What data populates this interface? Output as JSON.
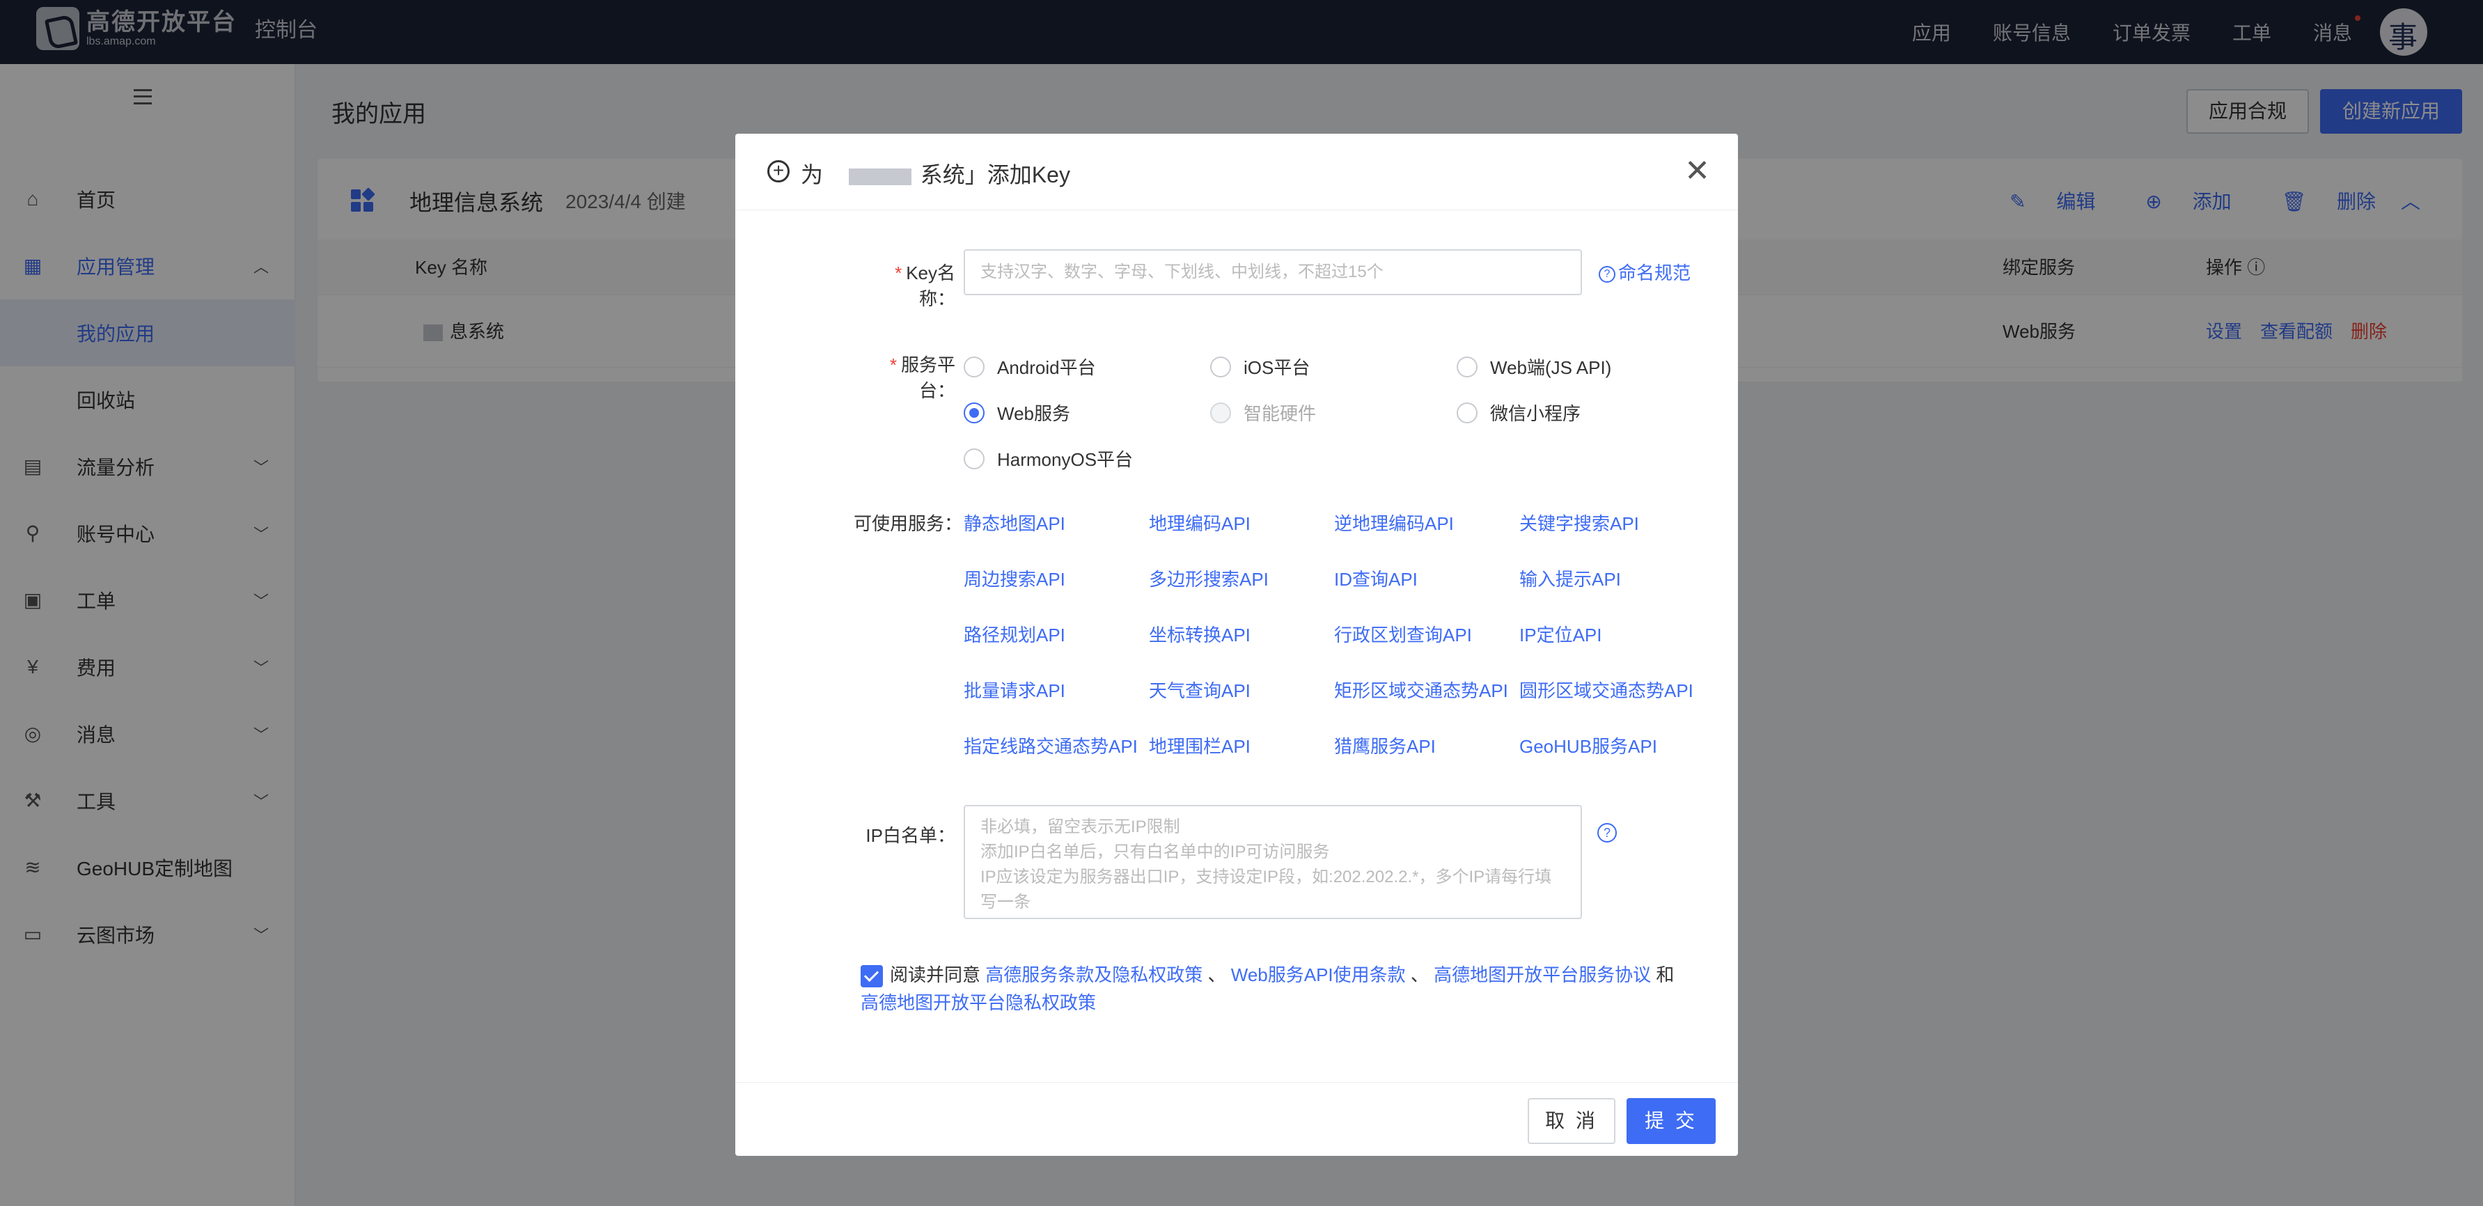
{
  "topbar": {
    "logo_name": "高德开放平台",
    "logo_domain": "lbs.amap.com",
    "console": "控制台",
    "nav": [
      "应用",
      "账号信息",
      "订单发票",
      "工单",
      "消息"
    ]
  },
  "sidebar": {
    "items": [
      {
        "label": "首页",
        "icon": "home-icon"
      },
      {
        "label": "应用管理",
        "icon": "grid-icon"
      },
      {
        "label": "我的应用"
      },
      {
        "label": "回收站"
      },
      {
        "label": "流量分析",
        "icon": "chart-icon"
      },
      {
        "label": "账号中心",
        "icon": "user-icon"
      },
      {
        "label": "工单",
        "icon": "ticket-icon"
      },
      {
        "label": "费用",
        "icon": "billing-icon"
      },
      {
        "label": "消息",
        "icon": "message-icon"
      },
      {
        "label": "工具",
        "icon": "wrench-icon"
      },
      {
        "label": "GeoHUB定制地图",
        "icon": "layers-icon"
      },
      {
        "label": "云图市场",
        "icon": "store-icon"
      }
    ]
  },
  "main": {
    "page_title": "我的应用",
    "compliance_button": "应用合规",
    "create_button": "创建新应用",
    "card": {
      "title": "地理信息系统",
      "date": "2023/4/4 创建",
      "actions": [
        "编辑",
        "添加",
        "删除"
      ],
      "columns": [
        "Key 名称",
        "绑定服务",
        "操作"
      ],
      "row": {
        "name": "息系统",
        "service": "Web服务",
        "ops": [
          "设置",
          "查看配额",
          "删除"
        ]
      }
    }
  },
  "modal": {
    "title_prefix": "为",
    "title_suffix": "系统」添加Key",
    "key_label": "Key名称：",
    "key_placeholder": "支持汉字、数字、字母、下划线、中划线，不超过15个",
    "naming_rule": "命名规范",
    "platform_label": "服务平台：",
    "platforms": [
      {
        "label": "Android平台",
        "checked": false,
        "disabled": false
      },
      {
        "label": "iOS平台",
        "checked": false,
        "disabled": false
      },
      {
        "label": "Web端(JS API)",
        "checked": false,
        "disabled": false
      },
      {
        "label": "Web服务",
        "checked": true,
        "disabled": false
      },
      {
        "label": "智能硬件",
        "checked": false,
        "disabled": true
      },
      {
        "label": "微信小程序",
        "checked": false,
        "disabled": false
      },
      {
        "label": "HarmonyOS平台",
        "checked": false,
        "disabled": false
      }
    ],
    "services_label": "可使用服务：",
    "services": [
      "静态地图API",
      "地理编码API",
      "逆地理编码API",
      "关键字搜索API",
      "周边搜索API",
      "多边形搜索API",
      "ID查询API",
      "输入提示API",
      "路径规划API",
      "坐标转换API",
      "行政区划查询API",
      "IP定位API",
      "批量请求API",
      "天气查询API",
      "矩形区域交通态势API",
      "圆形区域交通态势API",
      "指定线路交通态势API",
      "地理围栏API",
      "猎鹰服务API",
      "GeoHUB服务API"
    ],
    "ip_label": "IP白名单：",
    "ip_placeholder": "非必填，留空表示无IP限制\n添加IP白名单后，只有白名单中的IP可访问服务\nIP应该设定为服务器出口IP，支持设定IP段，如:202.202.2.*，多个IP请每行填写一条",
    "agree_text": "阅读并同意",
    "agree_links": [
      "高德服务条款及隐私权政策",
      "Web服务API使用条款",
      "高德地图开放平台服务协议",
      "高德地图开放平台隐私权政策"
    ],
    "sep": "、",
    "and": "和",
    "cancel": "取 消",
    "submit": "提 交"
  },
  "colors": {
    "accent": "#3e6cf4",
    "topbar": "#1c2438",
    "danger": "#f04134"
  }
}
